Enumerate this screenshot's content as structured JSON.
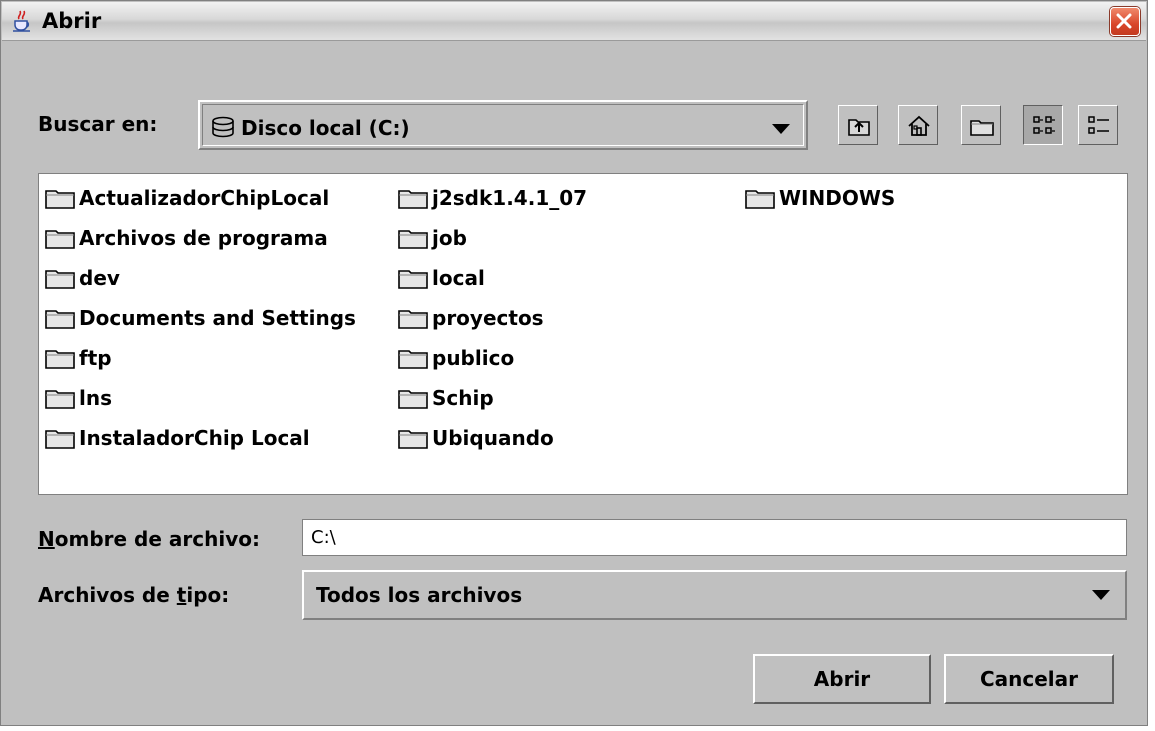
{
  "window": {
    "title": "Abrir"
  },
  "lookin": {
    "label": "Buscar en:",
    "value": "Disco local (C:)"
  },
  "toolbar": {
    "icons": [
      "up-one-level-icon",
      "home-icon",
      "new-folder-icon",
      "list-view-icon",
      "details-view-icon"
    ]
  },
  "files": [
    "ActualizadorChipLocal",
    "Archivos de programa",
    "dev",
    "Documents and Settings",
    "ftp",
    "lns",
    "InstaladorChip Local",
    "j2sdk1.4.1_07",
    "job",
    "local",
    "proyectos",
    "publico",
    "Schip",
    "Ubiquando",
    "WINDOWS"
  ],
  "filename": {
    "label_first": "N",
    "label_rest": "ombre de archivo:",
    "value": "C:\\"
  },
  "filetype": {
    "label_before": "Archivos de ",
    "label_ul": "t",
    "label_after": "ipo:",
    "value": "Todos los archivos"
  },
  "buttons": {
    "open": "Abrir",
    "cancel": "Cancelar"
  }
}
